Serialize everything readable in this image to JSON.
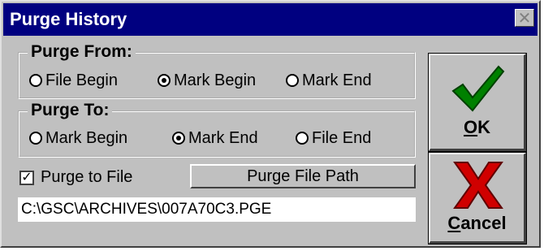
{
  "window": {
    "title": "Purge History",
    "close_glyph": "✕"
  },
  "purge_from": {
    "legend": "Purge From:",
    "options": [
      "File Begin",
      "Mark Begin",
      "Mark End"
    ],
    "selected": "Mark Begin"
  },
  "purge_to": {
    "legend": "Purge To:",
    "options": [
      "Mark Begin",
      "Mark End",
      "File End"
    ],
    "selected": "Mark End"
  },
  "purge_to_file": {
    "label": "Purge to File",
    "checked": true,
    "check_glyph": "✓"
  },
  "path_button_label": "Purge File Path",
  "path_value": "C:\\GSC\\ARCHIVES\\007A70C3.PGE",
  "ok_button": {
    "label_u": "O",
    "label_rest": "K",
    "icon": "green-check-icon",
    "color": "#008000"
  },
  "cancel_button": {
    "label_u": "C",
    "label_rest": "ancel",
    "icon": "red-x-icon",
    "color": "#d00000"
  }
}
